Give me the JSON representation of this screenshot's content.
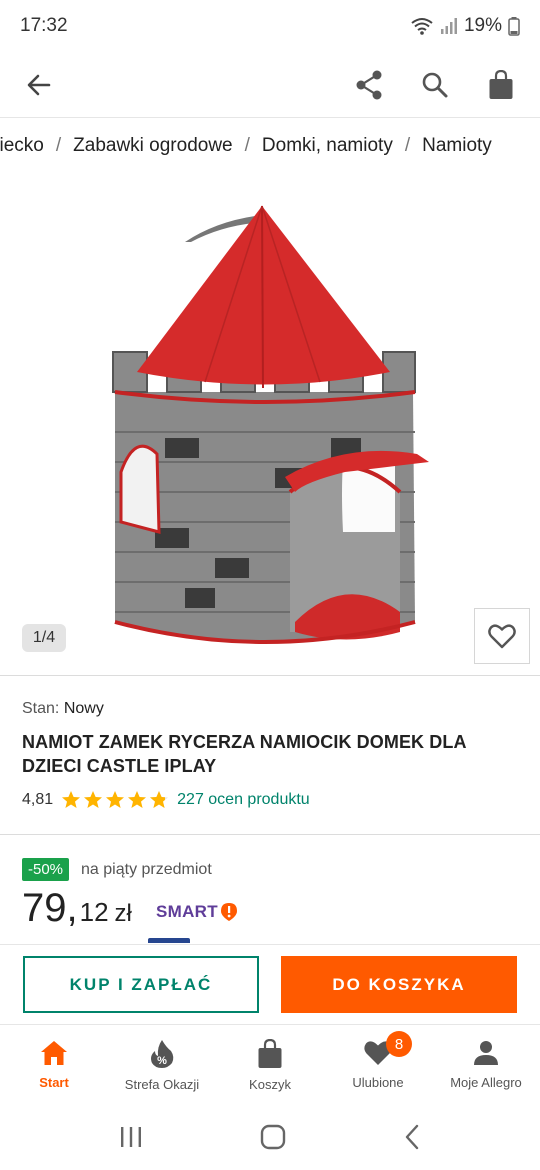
{
  "status_bar": {
    "time": "17:32",
    "battery": "19%"
  },
  "breadcrumb": {
    "items": [
      "ziecko",
      "Zabawki ogrodowe",
      "Domki, namioty",
      "Namioty"
    ],
    "separator": "/"
  },
  "gallery": {
    "counter": "1/4"
  },
  "product": {
    "condition_label": "Stan:",
    "condition_value": "Nowy",
    "title": "NAMIOT ZAMEK RYCERZA NAMIOCIK DOMEK DLA DZIECI CASTLE IPLAY",
    "rating": "4,81",
    "stars": 4.81,
    "reviews": "227 ocen produktu"
  },
  "promo": {
    "badge": "-50%",
    "text": "na piąty przedmiot"
  },
  "price": {
    "integer": "79,",
    "decimal": "12",
    "currency": "zł",
    "smart_label": "SMART"
  },
  "actions": {
    "buy_now": "KUP I ZAPŁAĆ",
    "add_to_cart": "DO KOSZYKA"
  },
  "bottom_nav": {
    "items": [
      {
        "label": "Start",
        "icon": "home-icon"
      },
      {
        "label": "Strefa Okazji",
        "icon": "deal-icon"
      },
      {
        "label": "Koszyk",
        "icon": "cart-icon"
      },
      {
        "label": "Ulubione",
        "icon": "heart-icon"
      },
      {
        "label": "Moje Allegro",
        "icon": "user-icon"
      }
    ],
    "favorites_badge": "8"
  },
  "colors": {
    "accent": "#ff5a00",
    "teal": "#00836b",
    "promo_green": "#1aa14b",
    "smart_purple": "#5f3d99"
  }
}
